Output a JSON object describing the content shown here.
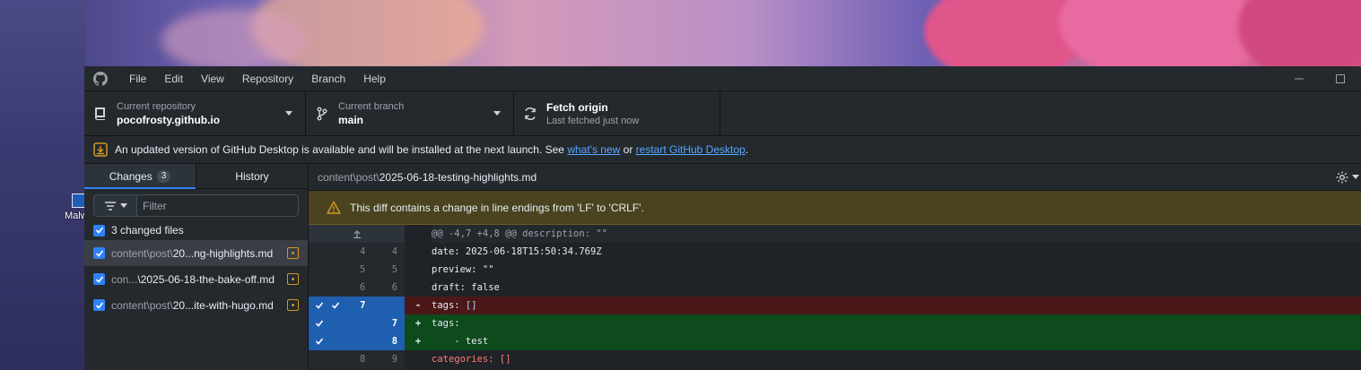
{
  "menu": [
    "File",
    "Edit",
    "View",
    "Repository",
    "Branch",
    "Help"
  ],
  "desktop": {
    "icon_label": "Malw"
  },
  "toolbar": {
    "repo_label": "Current repository",
    "repo_value": "pocofrosty.github.io",
    "branch_label": "Current branch",
    "branch_value": "main",
    "fetch_title": "Fetch origin",
    "fetch_sub": "Last fetched just now"
  },
  "banner": {
    "text_before": "An updated version of GitHub Desktop is available and will be installed at the next launch. See ",
    "link1": "what's new",
    "text_mid": " or ",
    "link2": "restart GitHub Desktop",
    "text_after": "."
  },
  "sidebar": {
    "tab_changes": "Changes",
    "changes_count": "3",
    "tab_history": "History",
    "filter_placeholder": "Filter",
    "changed_files": "3 changed files",
    "files": [
      {
        "dim": "content\\post\\",
        "name": "20...ng-highlights.md"
      },
      {
        "dim": "con...",
        "name": "\\2025-06-18-the-bake-off.md"
      },
      {
        "dim": "content\\post\\",
        "name": "20...ite-with-hugo.md"
      }
    ]
  },
  "diff": {
    "path_dim": "content\\post\\",
    "path_file": "2025-06-18-testing-highlights.md",
    "warning": "This diff contains a change in line endings from 'LF' to 'CRLF'.",
    "hunk_header": "@@ -4,7 +4,8 @@ description: \"\"",
    "lines": [
      {
        "old": "4",
        "new": "4",
        "mark": "",
        "key": "date:",
        "val": " 2025-06-18T15:50:34.769Z"
      },
      {
        "old": "5",
        "new": "5",
        "mark": "",
        "key": "preview:",
        "val": " \"\""
      },
      {
        "old": "6",
        "new": "6",
        "mark": "",
        "key": "draft:",
        "val": " false"
      },
      {
        "old": "7",
        "new": "",
        "mark": "-",
        "key": "tags:",
        "val": " []"
      },
      {
        "old": "",
        "new": "7",
        "mark": "+",
        "key": "tags:",
        "val": ""
      },
      {
        "old": "",
        "new": "8",
        "mark": "+",
        "key": "    - test",
        "val": ""
      },
      {
        "old": "8",
        "new": "9",
        "mark": "",
        "key": "categories:",
        "val": " []"
      }
    ]
  },
  "colors": {
    "accent": "#2f81f7",
    "added": "#0d4a1c",
    "deleted": "#4b1717",
    "warning": "#d29922"
  }
}
